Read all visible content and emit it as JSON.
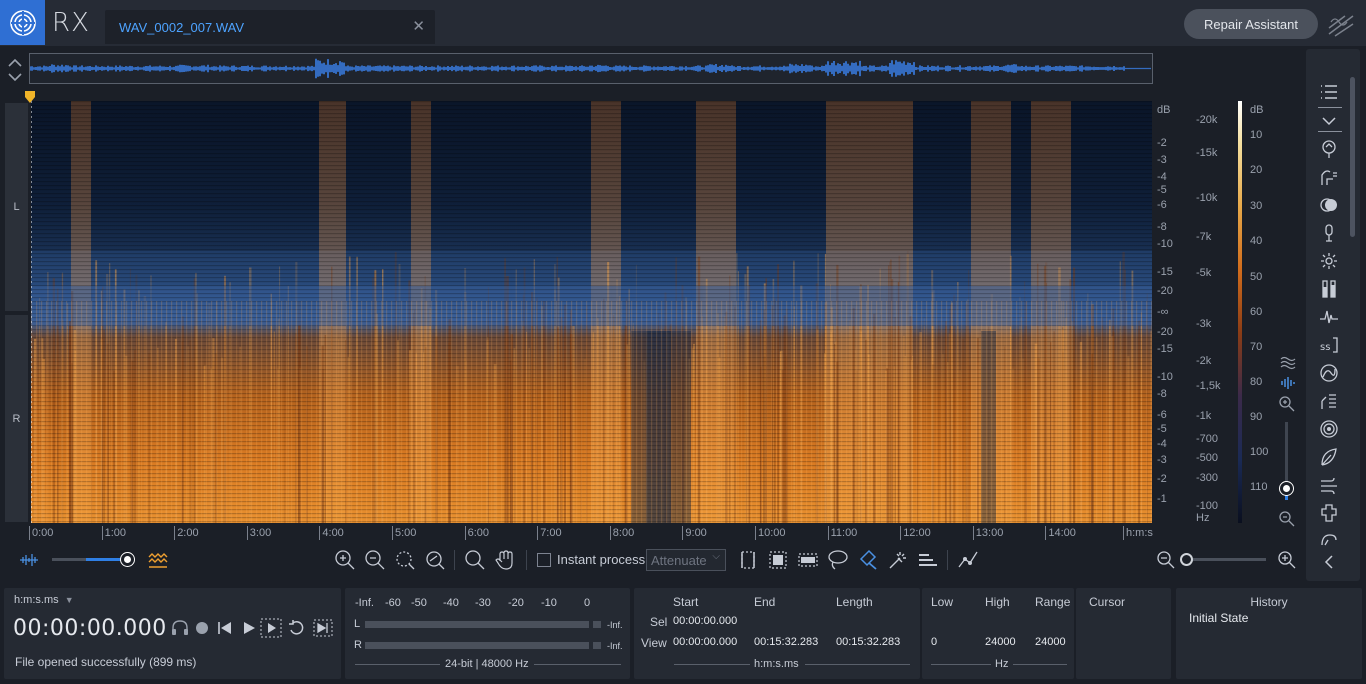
{
  "app": {
    "name": "RX",
    "file_tab": "WAV_0002_007.WAV",
    "repair_assistant": "Repair Assistant",
    "accent": "#2f6fd3",
    "waveform_color": "#3d8bff"
  },
  "channels": {
    "left": "L",
    "right": "R"
  },
  "db_scale": [
    "dB",
    "-2",
    "-3",
    "-4",
    "-5",
    "-6",
    "-8",
    "-10",
    "-15",
    "-20",
    "-∞",
    "-20",
    "-15",
    "-10",
    "-8",
    "-6",
    "-5",
    "-4",
    "-3",
    "-2",
    "-1"
  ],
  "hz_scale": [
    "-20k",
    "-15k",
    "-10k",
    "-7k",
    "-5k",
    "-3k",
    "-2k",
    "-1,5k",
    "-1k",
    "-700",
    "-500",
    "-300",
    "-100",
    "Hz"
  ],
  "color_scale": [
    "dB",
    "10",
    "20",
    "30",
    "40",
    "50",
    "60",
    "70",
    "80",
    "90",
    "100",
    "110"
  ],
  "time_ruler": [
    "0:00",
    "1:00",
    "2:00",
    "3:00",
    "4:00",
    "5:00",
    "6:00",
    "7:00",
    "8:00",
    "9:00",
    "10:00",
    "11:00",
    "12:00",
    "13:00",
    "14:00",
    "h:m:s"
  ],
  "toolbar": {
    "instant_process": "Instant process",
    "attenuate": "Attenuate"
  },
  "transport": {
    "time_format": "h:m:s.ms",
    "time": "00:00:00.000",
    "status": "File opened successfully (899 ms)"
  },
  "meter": {
    "scale": [
      "-Inf.",
      "-60",
      "-50",
      "-40",
      "-30",
      "-20",
      "-10",
      "0"
    ],
    "left": "L",
    "right": "R",
    "left_peak": "-Inf.",
    "right_peak": "-Inf.",
    "format": "24-bit | 48000 Hz"
  },
  "selection": {
    "start_header": "Start",
    "end_header": "End",
    "length_header": "Length",
    "sel_label": "Sel",
    "view_label": "View",
    "sel_start": "00:00:00.000",
    "view_start": "00:00:00.000",
    "view_end": "00:15:32.283",
    "view_length": "00:15:32.283",
    "unit": "h:m:s.ms",
    "low_header": "Low",
    "high_header": "High",
    "range_header": "Range",
    "cursor_header": "Cursor",
    "view_low": "0",
    "view_high": "24000",
    "view_range": "24000",
    "freq_unit": "Hz"
  },
  "history": {
    "title": "History",
    "items": [
      "Initial State"
    ]
  }
}
